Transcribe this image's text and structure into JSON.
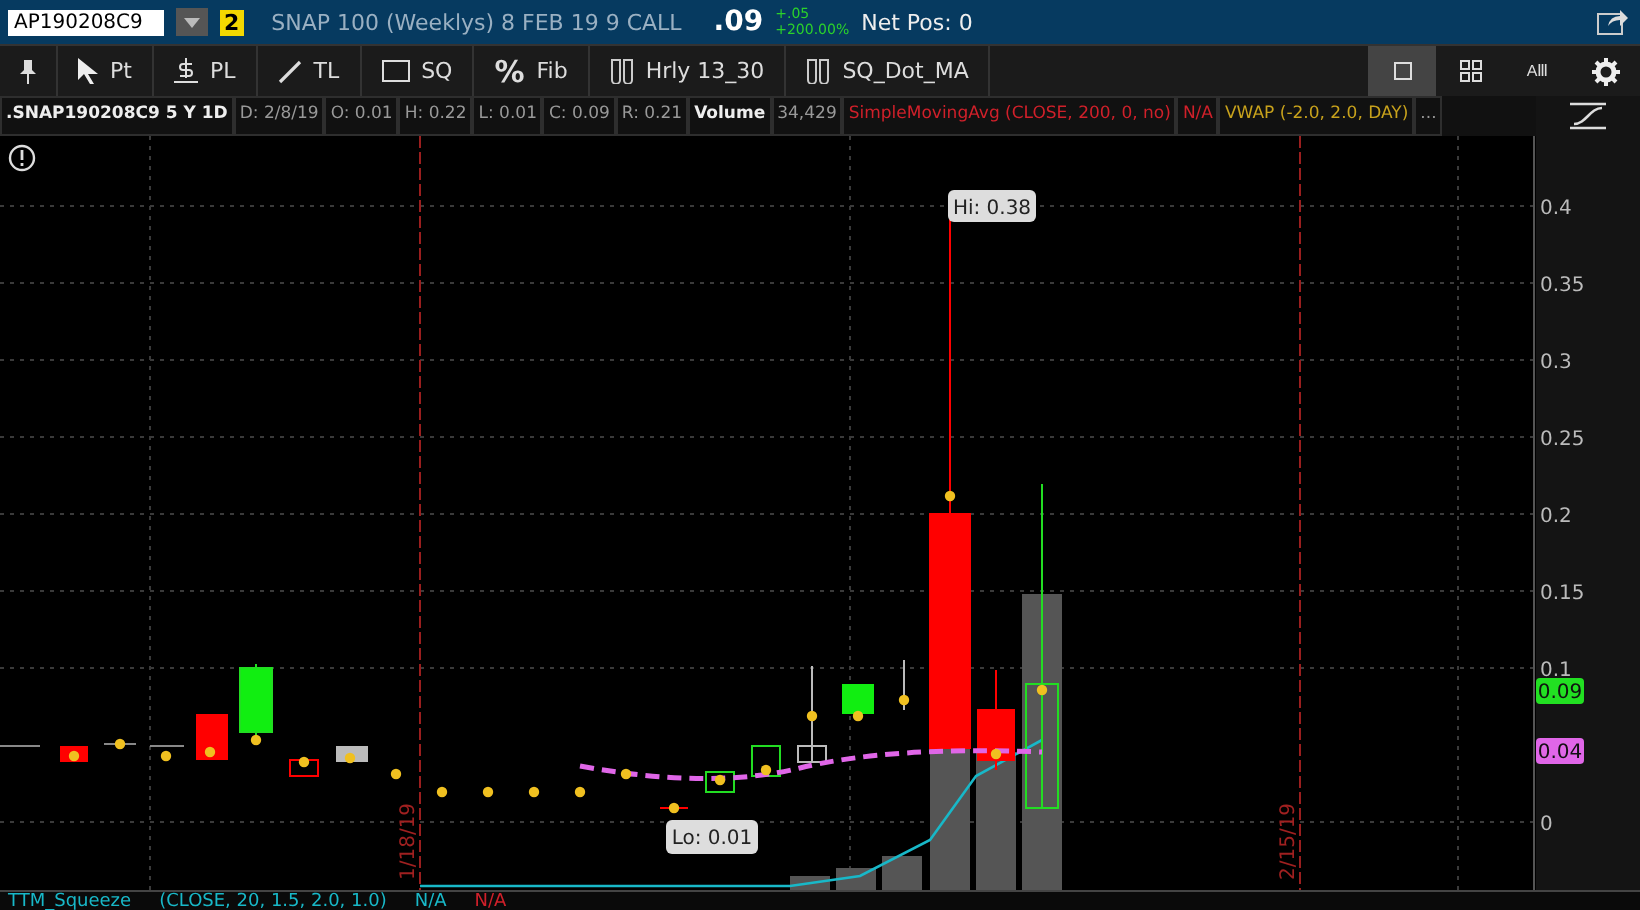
{
  "quote_bar": {
    "symbol": "AP190208C9",
    "link_badge": "2",
    "description": "SNAP 100 (Weeklys) 8 FEB 19 9 CALL",
    "last": ".09",
    "change": "+.05",
    "change_pct": "+200.00%",
    "net_pos": "Net Pos: 0"
  },
  "toolbar": {
    "tools": [
      {
        "kind": "pin"
      },
      {
        "kind": "pointer",
        "label": "Pt"
      },
      {
        "kind": "price-level",
        "label": "PL"
      },
      {
        "kind": "trendline",
        "label": "TL"
      },
      {
        "kind": "square",
        "label": "SQ"
      },
      {
        "kind": "fib",
        "label": "Fib",
        "glyph": "%"
      },
      {
        "kind": "study",
        "label": "Hrly 13_30"
      },
      {
        "kind": "study",
        "label": "SQ_Dot_MA"
      }
    ],
    "right": [
      {
        "kind": "single",
        "selected": true
      },
      {
        "kind": "grid",
        "selected": false
      },
      {
        "kind": "text",
        "label": "AⅢ",
        "selected": false
      },
      {
        "kind": "settings",
        "selected": false
      }
    ]
  },
  "legend": [
    {
      "text": ".SNAP190208C9 5 Y 1D",
      "kind": "title"
    },
    {
      "text": "D: 2/8/19",
      "kind": "stat"
    },
    {
      "text": "O: 0.01",
      "kind": "stat"
    },
    {
      "text": "H: 0.22",
      "kind": "stat"
    },
    {
      "text": "L: 0.01",
      "kind": "stat"
    },
    {
      "text": "C: 0.09",
      "kind": "stat"
    },
    {
      "text": "R: 0.21",
      "kind": "stat"
    },
    {
      "text": "Volume",
      "kind": "title"
    },
    {
      "text": "34,429",
      "kind": "stat"
    },
    {
      "text": "SimpleMovingAvg (CLOSE, 200, 0, no)",
      "kind": "study",
      "color": "#d0202a"
    },
    {
      "text": "N/A",
      "kind": "study",
      "color": "#d0202a"
    },
    {
      "text": "VWAP (-2.0, 2.0, DAY)",
      "kind": "study",
      "color": "#c8a21c"
    },
    {
      "text": "...",
      "kind": "more"
    }
  ],
  "chart": {
    "yticks": [
      "0.4",
      "0.35",
      "0.3",
      "0.25",
      "0.2",
      "0.15",
      "0.1",
      "0"
    ],
    "date_markers": [
      "1/18/19",
      "2/15/19"
    ],
    "hi_label": "Hi: 0.38",
    "lo_label": "Lo: 0.01",
    "price_tags": [
      {
        "text": "0.09",
        "color": "#22e022"
      },
      {
        "text": "0.04",
        "color": "#e066e8"
      }
    ]
  },
  "lower_study": [
    {
      "text": "TTM_Squeeze",
      "color": "#18b8c8"
    },
    {
      "text": "(CLOSE, 20, 1.5, 2.0, 1.0)",
      "color": "#18b8c8"
    },
    {
      "text": "N/A",
      "color": "#18b8c8"
    },
    {
      "text": "N/A",
      "color": "#d0202a"
    }
  ]
}
